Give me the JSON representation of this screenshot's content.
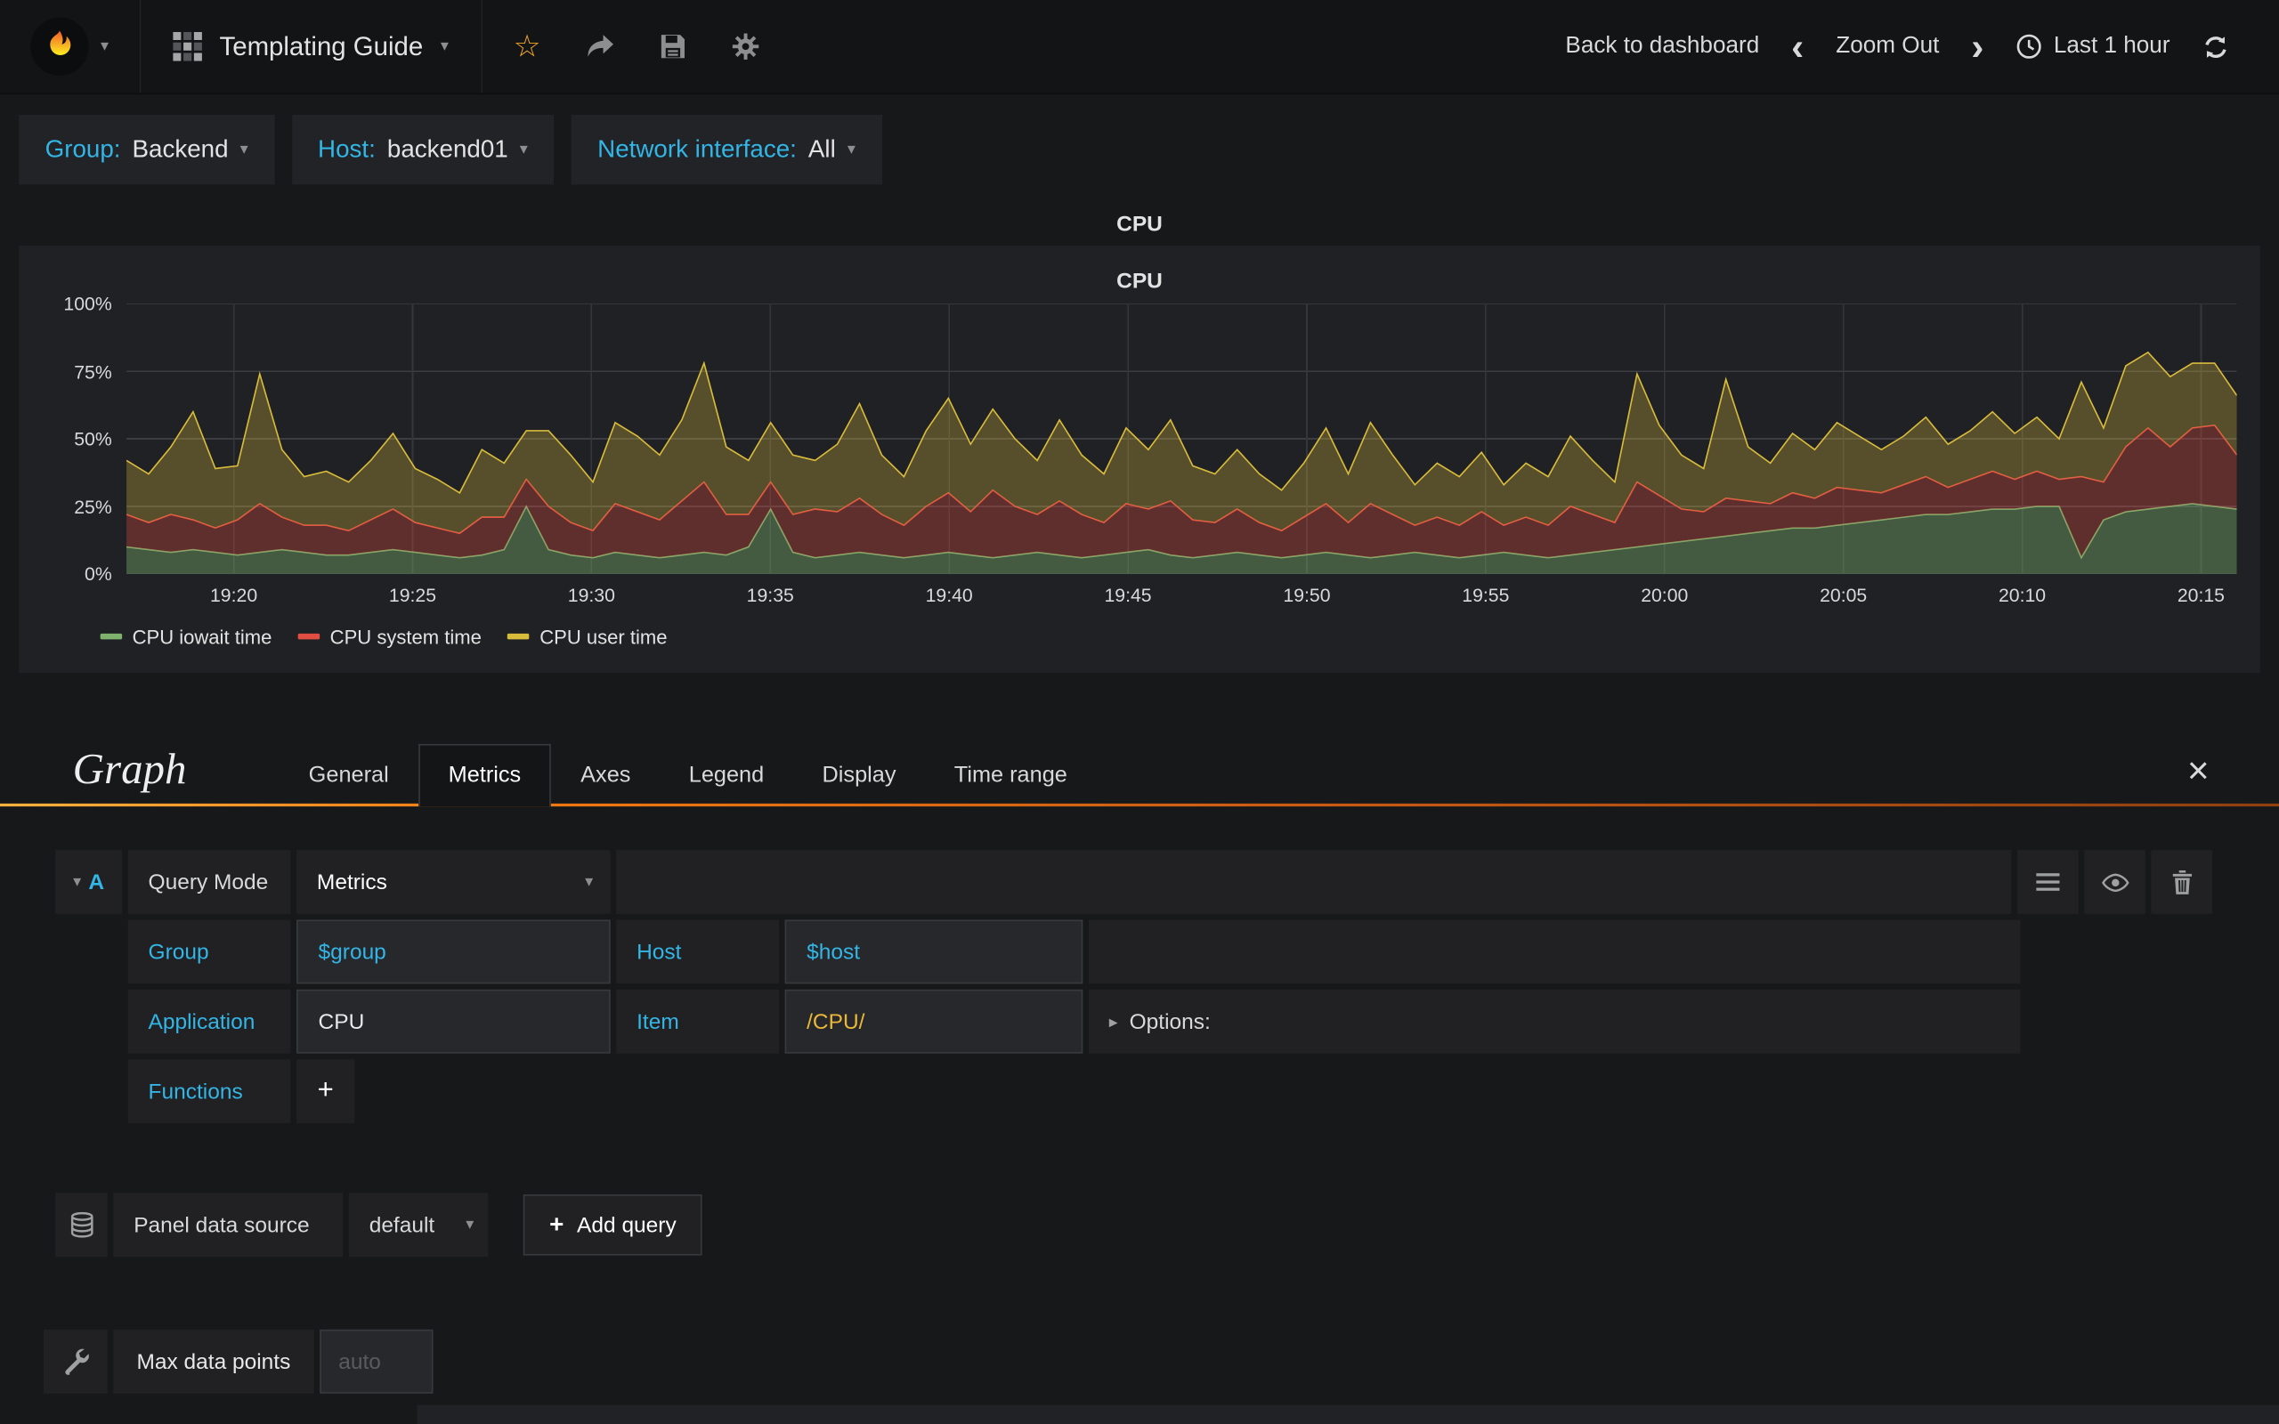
{
  "navbar": {
    "dashboard_title": "Templating Guide",
    "back_to_dashboard": "Back to dashboard",
    "zoom_out": "Zoom Out",
    "time_range": "Last 1 hour"
  },
  "variables": [
    {
      "label": "Group:",
      "value": "Backend"
    },
    {
      "label": "Host:",
      "value": "backend01"
    },
    {
      "label": "Network interface:",
      "value": "All"
    }
  ],
  "panel": {
    "title": "CPU",
    "chart_title": "CPU"
  },
  "chart_data": {
    "type": "area",
    "stacked": true,
    "title": "CPU",
    "xlabel": "",
    "ylabel": "",
    "ylim": [
      0,
      100
    ],
    "grid": true,
    "legend_position": "bottom",
    "y_ticks": [
      {
        "label": "0%",
        "value": 0
      },
      {
        "label": "25%",
        "value": 25
      },
      {
        "label": "50%",
        "value": 50
      },
      {
        "label": "75%",
        "value": 75
      },
      {
        "label": "100%",
        "value": 100
      }
    ],
    "x_start_min": 0,
    "x_end_min": 59,
    "x_ticks": [
      {
        "label": "19:20",
        "min": 3
      },
      {
        "label": "19:25",
        "min": 8
      },
      {
        "label": "19:30",
        "min": 13
      },
      {
        "label": "19:35",
        "min": 18
      },
      {
        "label": "19:40",
        "min": 23
      },
      {
        "label": "19:45",
        "min": 28
      },
      {
        "label": "19:50",
        "min": 33
      },
      {
        "label": "19:55",
        "min": 38
      },
      {
        "label": "20:00",
        "min": 43
      },
      {
        "label": "20:05",
        "min": 48
      },
      {
        "label": "20:10",
        "min": 53
      },
      {
        "label": "20:15",
        "min": 58
      }
    ],
    "series": [
      {
        "name": "CPU iowait time",
        "color": "#7eb26d",
        "fill_opacity": 0.4,
        "values": [
          10,
          9,
          8,
          9,
          8,
          7,
          8,
          9,
          8,
          7,
          7,
          8,
          9,
          8,
          7,
          6,
          7,
          9,
          25,
          9,
          7,
          6,
          8,
          7,
          6,
          7,
          8,
          7,
          10,
          24,
          8,
          6,
          7,
          8,
          7,
          6,
          7,
          8,
          7,
          6,
          7,
          8,
          7,
          6,
          7,
          8,
          9,
          7,
          6,
          7,
          8,
          7,
          6,
          7,
          8,
          7,
          6,
          7,
          8,
          7,
          6,
          7,
          8,
          7,
          6,
          7,
          8,
          9,
          10,
          11,
          12,
          13,
          14,
          15,
          16,
          17,
          17,
          18,
          19,
          20,
          21,
          22,
          22,
          23,
          24,
          24,
          25,
          25,
          6,
          20,
          23,
          24,
          25,
          26,
          25,
          24
        ]
      },
      {
        "name": "CPU system time",
        "color": "#e24d42",
        "fill_opacity": 0.32,
        "values": [
          12,
          10,
          14,
          11,
          9,
          13,
          18,
          12,
          10,
          11,
          9,
          12,
          15,
          11,
          10,
          9,
          14,
          12,
          10,
          16,
          12,
          10,
          18,
          16,
          14,
          20,
          26,
          15,
          12,
          10,
          14,
          18,
          16,
          20,
          15,
          12,
          18,
          22,
          16,
          25,
          18,
          14,
          20,
          16,
          12,
          18,
          15,
          20,
          14,
          12,
          16,
          12,
          10,
          14,
          18,
          12,
          20,
          15,
          10,
          14,
          12,
          16,
          10,
          14,
          12,
          18,
          14,
          10,
          24,
          18,
          12,
          10,
          14,
          12,
          10,
          13,
          11,
          14,
          12,
          10,
          12,
          14,
          10,
          12,
          14,
          11,
          13,
          10,
          30,
          14,
          24,
          30,
          22,
          28,
          30,
          20
        ]
      },
      {
        "name": "CPU user time",
        "color": "#d9bb3c",
        "fill_opacity": 0.3,
        "values": [
          20,
          18,
          25,
          40,
          22,
          20,
          48,
          25,
          18,
          20,
          18,
          22,
          28,
          20,
          18,
          15,
          25,
          20,
          18,
          28,
          25,
          18,
          30,
          28,
          24,
          30,
          44,
          25,
          20,
          22,
          22,
          18,
          25,
          35,
          22,
          18,
          28,
          35,
          25,
          30,
          25,
          20,
          30,
          22,
          18,
          28,
          22,
          30,
          20,
          18,
          22,
          18,
          15,
          20,
          28,
          18,
          30,
          22,
          15,
          20,
          18,
          22,
          15,
          20,
          18,
          26,
          20,
          15,
          40,
          26,
          20,
          16,
          44,
          20,
          15,
          22,
          18,
          24,
          20,
          16,
          18,
          22,
          16,
          18,
          22,
          17,
          20,
          15,
          35,
          20,
          30,
          28,
          26,
          24,
          23,
          22
        ]
      }
    ]
  },
  "editor": {
    "title": "Graph",
    "tabs": [
      {
        "label": "General"
      },
      {
        "label": "Metrics",
        "active": true
      },
      {
        "label": "Axes"
      },
      {
        "label": "Legend"
      },
      {
        "label": "Display"
      },
      {
        "label": "Time range"
      }
    ],
    "close_label": "×",
    "query": {
      "ref": "A",
      "mode_label": "Query Mode",
      "mode_value": "Metrics",
      "group_label": "Group",
      "group_value": "$group",
      "host_label": "Host",
      "host_value": "$host",
      "application_label": "Application",
      "application_value": "CPU",
      "item_label": "Item",
      "item_value": "/CPU/",
      "options_label": "Options:",
      "functions_label": "Functions",
      "add_function_label": "+"
    },
    "datasource": {
      "label": "Panel data source",
      "value": "default",
      "plus": "+",
      "add_query_label": "Add query"
    },
    "metrics_options": {
      "max_data_points_label": "Max data points",
      "max_data_points_placeholder": "auto"
    }
  }
}
